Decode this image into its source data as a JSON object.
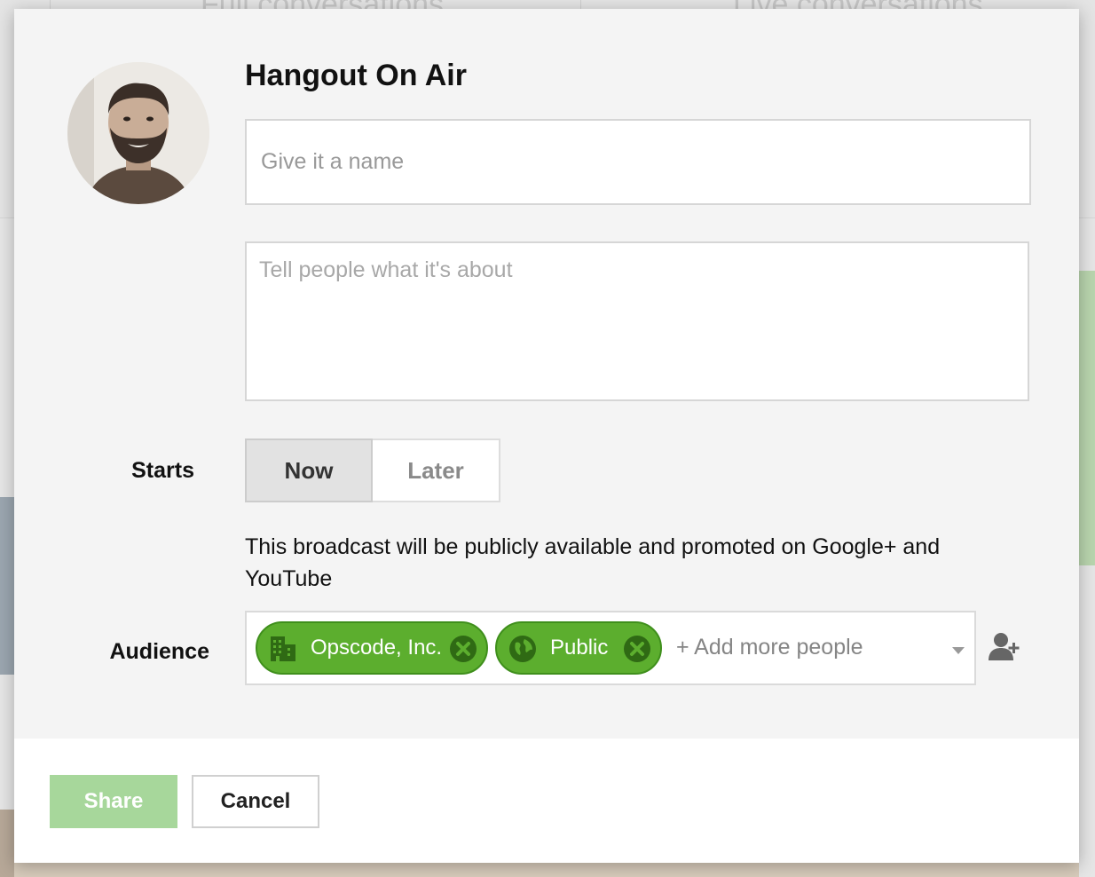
{
  "background": {
    "tabs": [
      "Full conversations",
      "Live conversations"
    ]
  },
  "dialog": {
    "title": "Hangout On Air",
    "name_field": {
      "placeholder": "Give it a name",
      "value": ""
    },
    "about_field": {
      "placeholder": "Tell people what it's about",
      "value": ""
    },
    "starts": {
      "label": "Starts",
      "options": [
        "Now",
        "Later"
      ],
      "selected": "Now"
    },
    "broadcast_note": "This broadcast will be publicly available and promoted on Google+ and YouTube",
    "audience": {
      "label": "Audience",
      "chips": [
        {
          "label": "Opscode, Inc.",
          "icon": "building-icon"
        },
        {
          "label": "Public",
          "icon": "globe-icon"
        }
      ],
      "add_placeholder": "+ Add more people"
    },
    "footer": {
      "share_label": "Share",
      "cancel_label": "Cancel"
    },
    "colors": {
      "chip_green": "#5cae2e",
      "share_disabled_green": "#a7d79b"
    }
  }
}
